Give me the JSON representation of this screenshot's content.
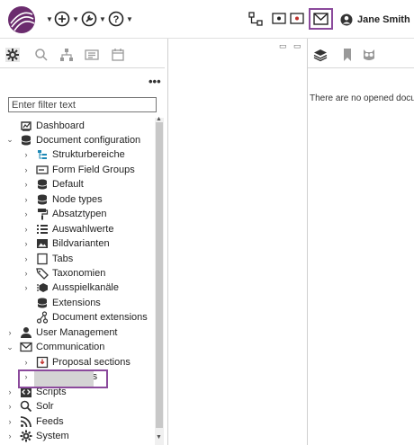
{
  "user": {
    "name": "Jane Smith"
  },
  "sidebar": {
    "filter_placeholder": "Enter filter text",
    "more_label": "•••"
  },
  "tree": [
    {
      "label": "Dashboard",
      "icon": "dashboard-icon",
      "level": 1,
      "chevron": ""
    },
    {
      "label": "Document configuration",
      "icon": "database-icon",
      "level": 1,
      "chevron": "⌄"
    },
    {
      "label": "Strukturbereiche",
      "icon": "structure-icon",
      "level": 2,
      "chevron": "›"
    },
    {
      "label": "Form Field Groups",
      "icon": "form-field-icon",
      "level": 2,
      "chevron": "›"
    },
    {
      "label": "Default",
      "icon": "database-icon",
      "level": 2,
      "chevron": "›"
    },
    {
      "label": "Node types",
      "icon": "database-icon",
      "level": 2,
      "chevron": "›"
    },
    {
      "label": "Absatztypen",
      "icon": "paint-roller-icon",
      "level": 2,
      "chevron": "›"
    },
    {
      "label": "Auswahlwerte",
      "icon": "list-icon",
      "level": 2,
      "chevron": "›"
    },
    {
      "label": "Bildvarianten",
      "icon": "image-icon",
      "level": 2,
      "chevron": "›"
    },
    {
      "label": "Tabs",
      "icon": "tab-icon",
      "level": 2,
      "chevron": "›"
    },
    {
      "label": "Taxonomien",
      "icon": "tags-icon",
      "level": 2,
      "chevron": "›"
    },
    {
      "label": "Ausspielkanäle",
      "icon": "channels-icon",
      "level": 2,
      "chevron": "›"
    },
    {
      "label": "Extensions",
      "icon": "database-icon",
      "level": 2,
      "chevron": ""
    },
    {
      "label": "Document extensions",
      "icon": "nodes-icon",
      "level": 2,
      "chevron": ""
    },
    {
      "label": "User Management",
      "icon": "user-icon",
      "level": 1,
      "chevron": "›"
    },
    {
      "label": "Communication",
      "icon": "mail-icon",
      "level": 1,
      "chevron": "⌄"
    },
    {
      "label": "Proposal sections",
      "icon": "inbox-icon",
      "level": 2,
      "chevron": "›"
    },
    {
      "label": "Messages",
      "icon": "mail-icon",
      "level": 2,
      "chevron": "›"
    },
    {
      "label": "Scripts",
      "icon": "code-icon",
      "level": 1,
      "chevron": "›"
    },
    {
      "label": "Solr",
      "icon": "search-icon",
      "level": 1,
      "chevron": "›"
    },
    {
      "label": "Feeds",
      "icon": "rss-icon",
      "level": 1,
      "chevron": "›"
    },
    {
      "label": "System",
      "icon": "gear-icon",
      "level": 1,
      "chevron": "›"
    }
  ],
  "editor": {
    "empty_message": "There are no opened docu"
  },
  "colors": {
    "brand": "#6b2c6e",
    "highlight": "#8b4a9c"
  }
}
